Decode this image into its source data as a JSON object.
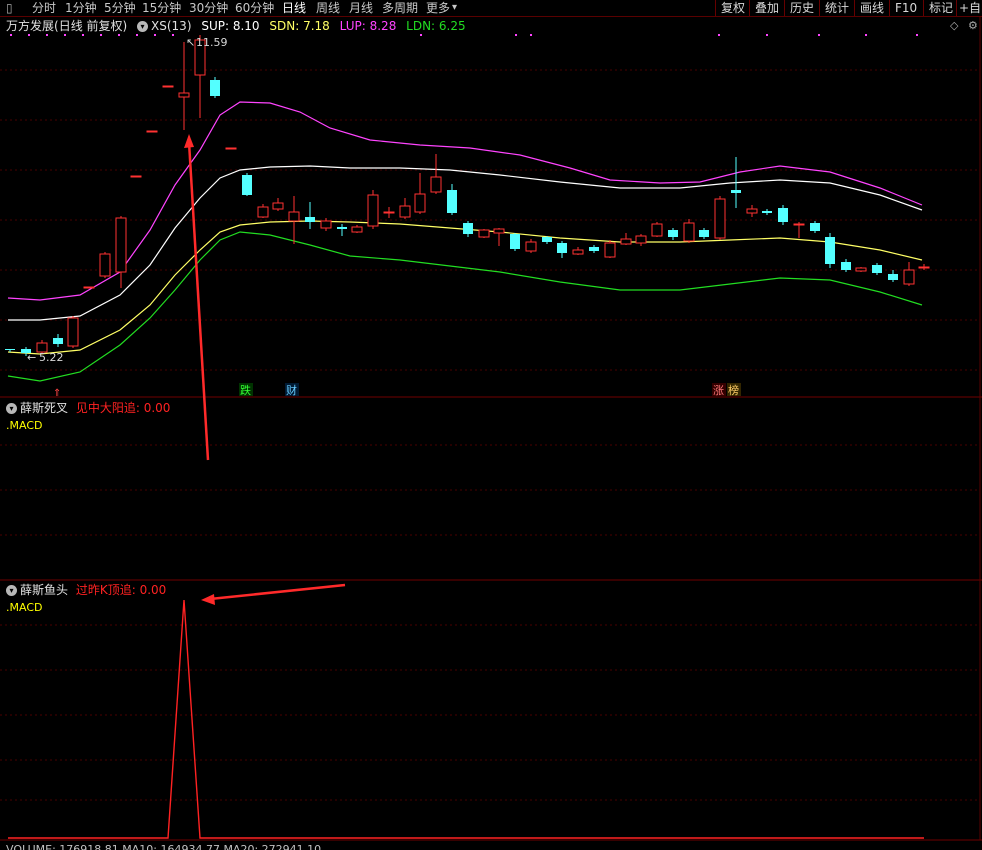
{
  "toolbar": {
    "periods": [
      "分时",
      "1分钟",
      "5分钟",
      "15分钟",
      "30分钟",
      "60分钟",
      "日线",
      "周线",
      "月线",
      "多周期",
      "更多"
    ],
    "active_period": "日线",
    "right_buttons": [
      "复权",
      "叠加",
      "历史",
      "统计",
      "画线",
      "F10",
      "标记",
      "+自"
    ]
  },
  "main_panel": {
    "stock_name": "万方发展",
    "mode": "(日线 前复权)",
    "indicator": "XS(13)",
    "sup": "SUP: 8.10",
    "sdn": "SDN: 7.18",
    "lup": "LUP: 8.28",
    "ldn": "LDN: 6.25",
    "high_label": "11.59",
    "low_label": "5.22",
    "event_tags": [
      "跌",
      "财",
      "涨",
      "榜"
    ]
  },
  "panel2": {
    "name": "薛斯死叉",
    "signal": "见中大阳追: 0.00",
    "sub": ".MACD"
  },
  "panel3": {
    "name": "薛斯鱼头",
    "signal": "过昨K顶追: 0.00",
    "sub": ".MACD"
  },
  "bottom_row": "VOLUME: 176918.81  MA10: 164934.77  MA20: 272941.10",
  "colors": {
    "up": "#ff3232",
    "down": "#54ffff",
    "bg": "#000000",
    "grid": "#5a0000",
    "sup": "#ffffff",
    "sdn": "#ffff66",
    "lup": "#ff44ff",
    "ldn": "#22dd22",
    "arrow": "#ff2a2a",
    "signal": "#ff2222",
    "macd_label": "#ffff00"
  }
}
